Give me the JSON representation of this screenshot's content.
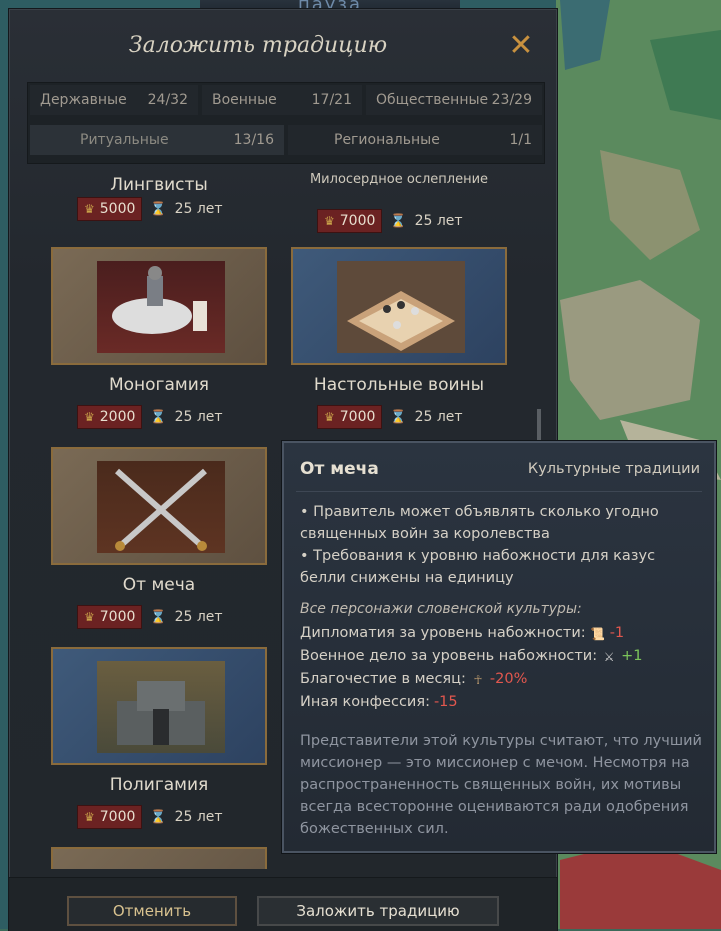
{
  "banner_text": "пауза",
  "dialog": {
    "title": "Заложить традицию",
    "close_icon": "close-x-icon"
  },
  "tabs": [
    {
      "label": "Державные",
      "count": "24/32"
    },
    {
      "label": "Военные",
      "count": "17/21"
    },
    {
      "label": "Общественные",
      "count": "23/29"
    },
    {
      "label": "Ритуальные",
      "count": "13/16"
    },
    {
      "label": "Региональные",
      "count": "1/1"
    }
  ],
  "traditions": [
    {
      "name": "Лингвисты",
      "cost": "5000",
      "years": "25 лет"
    },
    {
      "name": "Милосердное ослепление",
      "cost": "7000",
      "years": "25 лет"
    },
    {
      "name": "Моногамия",
      "cost": "2000",
      "years": "25 лет"
    },
    {
      "name": "Настольные воины",
      "cost": "7000",
      "years": "25 лет"
    },
    {
      "name": "От меча",
      "cost": "7000",
      "years": "25 лет"
    },
    {
      "name": "Полигамия",
      "cost": "7000",
      "years": "25 лет"
    }
  ],
  "footer": {
    "cancel_label": "Отменить",
    "found_label": "Заложить традицию"
  },
  "tooltip": {
    "title": "От меча",
    "category": "Культурные традиции",
    "bullets": [
      "• Правитель может объявлять сколько угодно священных войн за королевства",
      "• Требования к уровню набожности для казус белли снижены на единицу"
    ],
    "subheader": "Все персонажи словенской культуры:",
    "modifiers": [
      {
        "label": "Дипломатия за уровень набожности:",
        "icon": "scroll-icon",
        "value": "-1"
      },
      {
        "label": "Военное дело за уровень набожности:",
        "icon": "crossed-swords-icon",
        "value": "+1"
      },
      {
        "label": "Благочестие в месяц:",
        "icon": "piety-figure-icon",
        "value": "-20%"
      },
      {
        "label": "Иная конфессия:",
        "icon": "",
        "value": "-15"
      }
    ],
    "flavor": "Представители этой культуры считают, что лучший миссионер — это миссионер с мечом. Несмотря на распространенность священных войн, их мотивы всегда всесторонне оцениваются ради одобрения божественных сил."
  },
  "colors": {
    "gold_cost_bg": "#6b2222",
    "negative": "#e2574e",
    "positive": "#7cc55a",
    "accent": "#c8913f"
  }
}
